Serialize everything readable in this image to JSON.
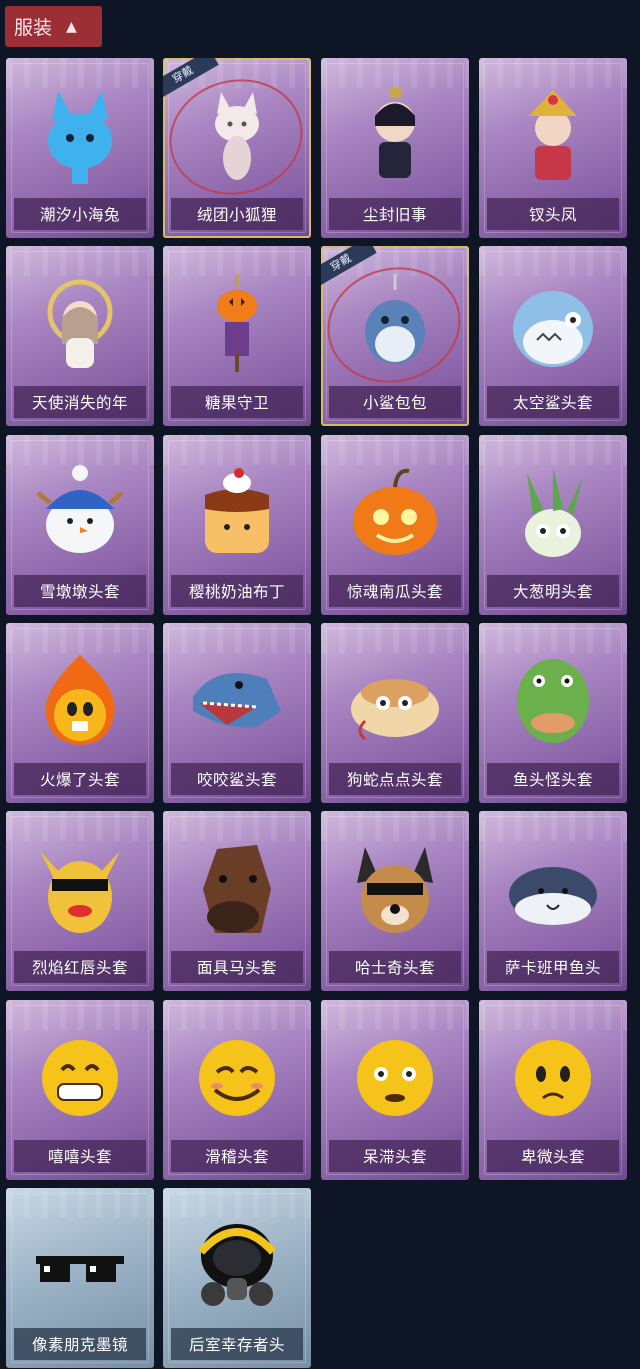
{
  "header": {
    "title": "服装",
    "chevron_icon": "chevron-up-icon"
  },
  "equipped_tag": "穿戴",
  "items": [
    {
      "name": "潮汐小海兔",
      "icon": "blue-rabbit-figure-icon",
      "equipped": false,
      "bg": "purple"
    },
    {
      "name": "绒团小狐狸",
      "icon": "white-fox-pendant-icon",
      "equipped": true,
      "bg": "purple"
    },
    {
      "name": "尘封旧事",
      "icon": "dark-prince-figure-icon",
      "equipped": false,
      "bg": "purple"
    },
    {
      "name": "钗头凤",
      "icon": "phoenix-crown-doll-icon",
      "equipped": false,
      "bg": "purple"
    },
    {
      "name": "天使消失的年",
      "icon": "angel-doll-icon",
      "equipped": false,
      "bg": "purple"
    },
    {
      "name": "糖果守卫",
      "icon": "pumpkin-scarecrow-icon",
      "equipped": false,
      "bg": "purple"
    },
    {
      "name": "小鲨包包",
      "icon": "shark-pendant-icon",
      "equipped": true,
      "bg": "purple"
    },
    {
      "name": "太空鲨头套",
      "icon": "space-shark-head-icon",
      "equipped": false,
      "bg": "purple"
    },
    {
      "name": "雪墩墩头套",
      "icon": "snowman-head-icon",
      "equipped": false,
      "bg": "purple"
    },
    {
      "name": "樱桃奶油布丁",
      "icon": "pudding-head-icon",
      "equipped": false,
      "bg": "purple"
    },
    {
      "name": "惊魂南瓜头套",
      "icon": "pumpkin-head-icon",
      "equipped": false,
      "bg": "purple"
    },
    {
      "name": "大葱明头套",
      "icon": "scallion-head-icon",
      "equipped": false,
      "bg": "purple"
    },
    {
      "name": "火爆了头套",
      "icon": "fire-head-icon",
      "equipped": false,
      "bg": "purple"
    },
    {
      "name": "咬咬鲨头套",
      "icon": "biting-shark-head-icon",
      "equipped": false,
      "bg": "purple"
    },
    {
      "name": "狗蛇点点头套",
      "icon": "snake-head-icon",
      "equipped": false,
      "bg": "purple"
    },
    {
      "name": "鱼头怪头套",
      "icon": "fish-monster-head-icon",
      "equipped": false,
      "bg": "purple"
    },
    {
      "name": "烈焰红唇头套",
      "icon": "red-lips-head-icon",
      "equipped": false,
      "bg": "purple"
    },
    {
      "name": "面具马头套",
      "icon": "horse-mask-head-icon",
      "equipped": false,
      "bg": "purple"
    },
    {
      "name": "哈士奇头套",
      "icon": "husky-head-icon",
      "equipped": false,
      "bg": "purple"
    },
    {
      "name": "萨卡班甲鱼头",
      "icon": "sacabambaspis-head-icon",
      "equipped": false,
      "bg": "purple"
    },
    {
      "name": "嘻嘻头套",
      "icon": "grin-emoji-head-icon",
      "equipped": false,
      "bg": "purple"
    },
    {
      "name": "滑稽头套",
      "icon": "smirk-emoji-head-icon",
      "equipped": false,
      "bg": "purple"
    },
    {
      "name": "呆滞头套",
      "icon": "stunned-emoji-head-icon",
      "equipped": false,
      "bg": "purple"
    },
    {
      "name": "卑微头套",
      "icon": "pleading-emoji-head-icon",
      "equipped": false,
      "bg": "purple"
    },
    {
      "name": "像素朋克墨镜",
      "icon": "pixel-sunglasses-icon",
      "equipped": false,
      "bg": "blue"
    },
    {
      "name": "后室幸存者头",
      "icon": "gas-mask-helmet-icon",
      "equipped": false,
      "bg": "blue"
    }
  ]
}
